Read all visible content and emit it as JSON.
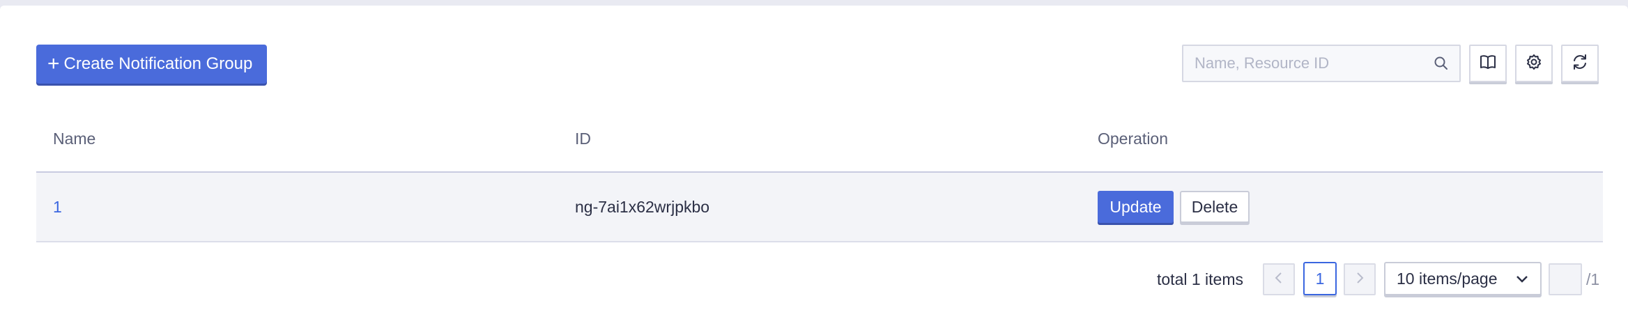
{
  "toolbar": {
    "create_label": "Create Notification Group",
    "search_placeholder": "Name, Resource ID",
    "search_value": ""
  },
  "table": {
    "headers": {
      "name": "Name",
      "id": "ID",
      "operation": "Operation"
    },
    "rows": [
      {
        "name": "1",
        "id": "ng-7ai1x62wrjpkbo",
        "update": "Update",
        "delete": "Delete"
      }
    ]
  },
  "pagination": {
    "total_text": "total 1 items",
    "current_page": "1",
    "page_size": "10 items/page",
    "total_pages": "/1",
    "jump_value": ""
  },
  "colors": {
    "primary": "#4a6bdb",
    "link": "#3a66e0",
    "row_bg": "#f3f4f8"
  },
  "icons": {
    "search": "search-icon",
    "docs": "book-icon",
    "settings": "gear-icon",
    "refresh": "refresh-icon",
    "prev": "chevron-left-icon",
    "next": "chevron-right-icon",
    "dropdown": "chevron-down-icon"
  }
}
